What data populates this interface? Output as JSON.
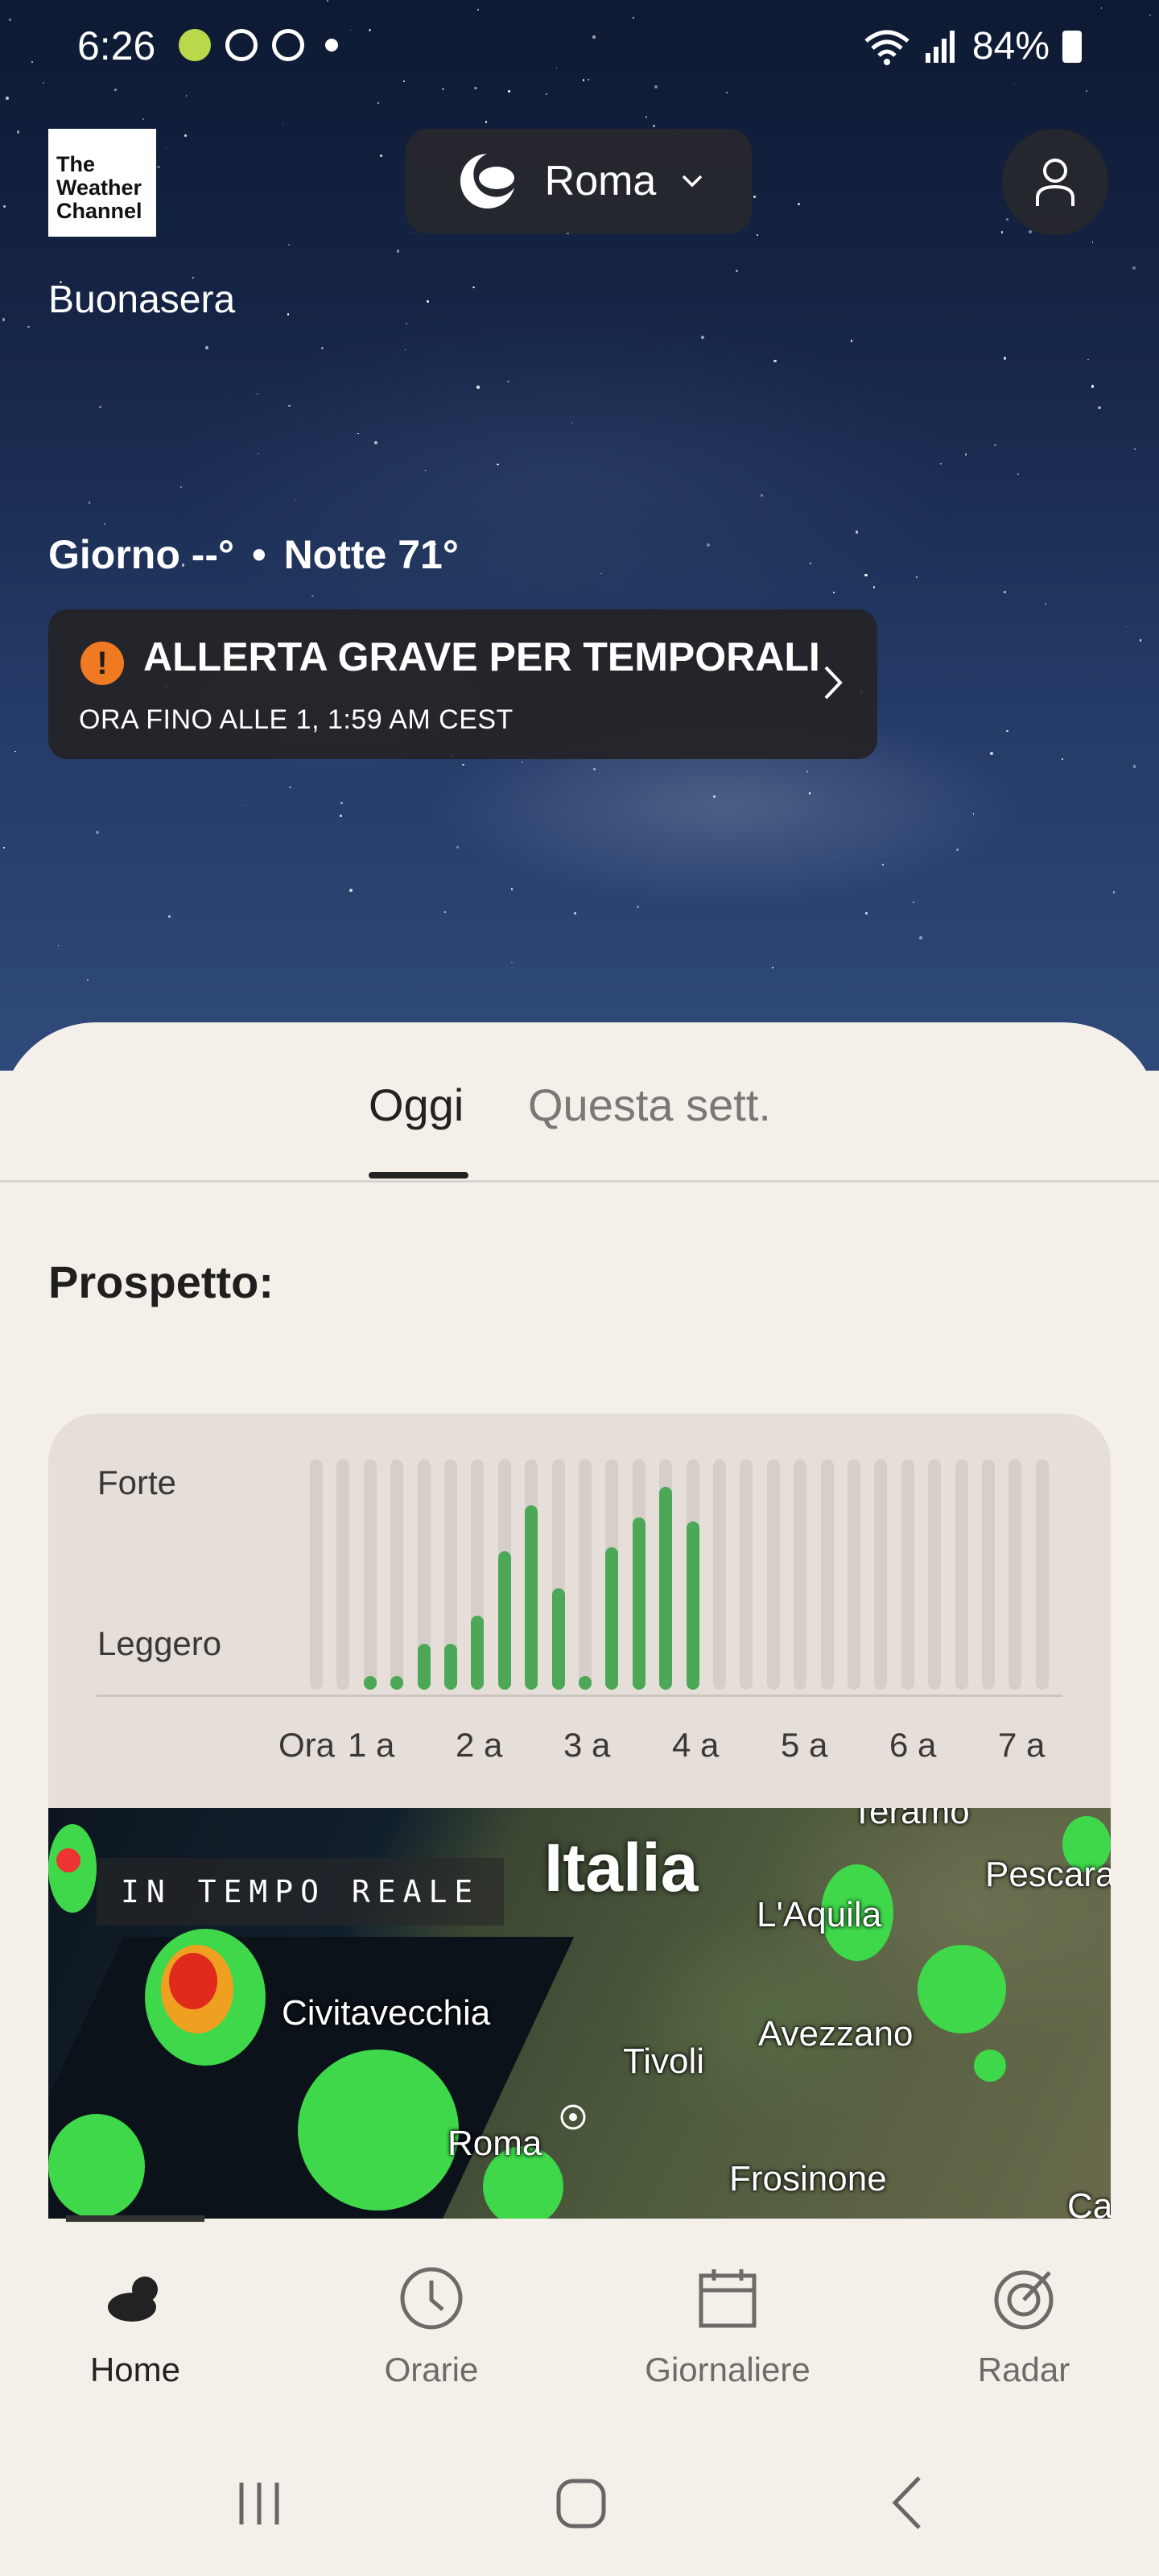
{
  "status_bar": {
    "time": "6:26",
    "battery": "84%"
  },
  "header": {
    "logo": [
      "The",
      "Weather",
      "Channel"
    ],
    "location": "Roma",
    "greeting": "Buonasera"
  },
  "today": {
    "day": "Giorno --°",
    "separator": "•",
    "night": "Notte 71°"
  },
  "alert": {
    "icon": "!",
    "title": "ALLERTA GRAVE PER TEMPORALI",
    "subtitle": "ORA FINO ALLE 1, 1:59 AM CEST",
    "color": "#f07a22"
  },
  "tabs": [
    {
      "label": "Oggi",
      "active": true
    },
    {
      "label": "Questa sett.",
      "active": false
    }
  ],
  "section_title": "Prospetto:",
  "chart_data": {
    "type": "bar",
    "ylabels": {
      "top": "Forte",
      "bottom": "Leggero"
    },
    "xticks": [
      "Ora",
      "1 a",
      "2 a",
      "3 a",
      "4 a",
      "5 a",
      "6 a",
      "7 a"
    ],
    "values": [
      0,
      0,
      0.06,
      0.06,
      0.2,
      0.2,
      0.32,
      0.6,
      0.8,
      0.44,
      0.06,
      0.62,
      0.75,
      0.88,
      0.73,
      0,
      0,
      0,
      0,
      0,
      0,
      0,
      0,
      0,
      0,
      0,
      0,
      0
    ],
    "ylim": [
      0,
      1
    ],
    "bar_color": "#4ca857"
  },
  "map": {
    "badge": "IN TEMPO REALE",
    "country": "Italia",
    "cities": [
      "Teramo",
      "Pescara",
      "L'Aquila",
      "Civitavecchia",
      "Avezzano",
      "Tivoli",
      "Roma",
      "Frosinone",
      "Ca"
    ]
  },
  "bottom_nav": [
    {
      "label": "Home",
      "icon": "cloud-icon",
      "active": true
    },
    {
      "label": "Orarie",
      "icon": "clock-icon",
      "active": false
    },
    {
      "label": "Giornaliere",
      "icon": "calendar-icon",
      "active": false
    },
    {
      "label": "Radar",
      "icon": "radar-icon",
      "active": false
    }
  ]
}
